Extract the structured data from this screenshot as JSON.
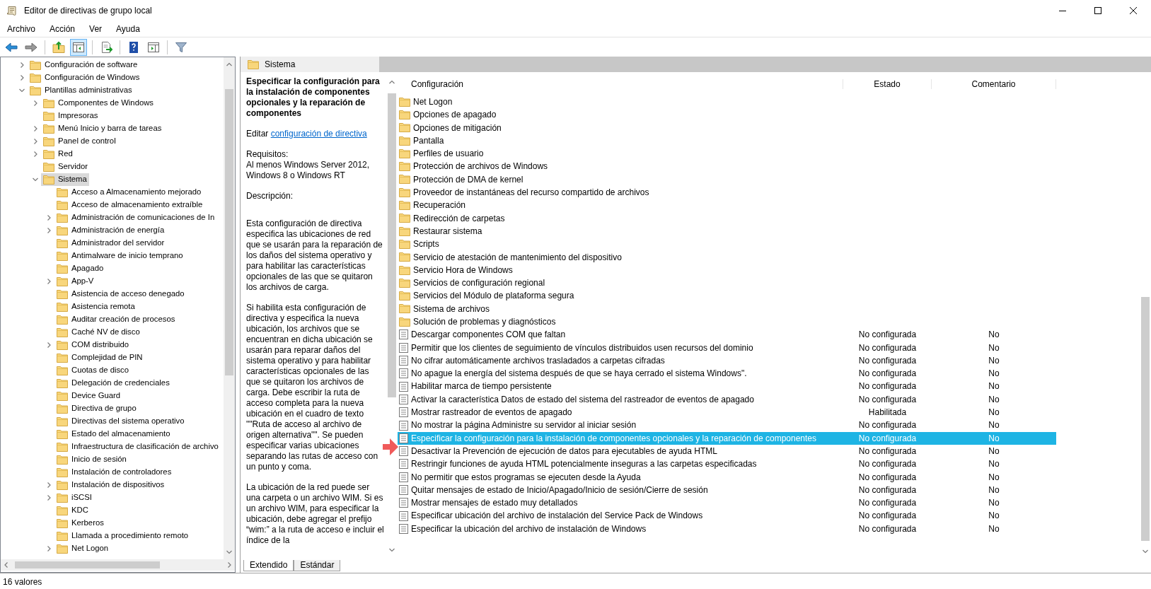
{
  "window": {
    "title": "Editor de directivas de grupo local"
  },
  "menu": [
    "Archivo",
    "Acción",
    "Ver",
    "Ayuda"
  ],
  "toolbar": [
    [
      {
        "kind": "back",
        "pressed": false
      },
      {
        "kind": "forward",
        "pressed": false
      }
    ],
    [
      {
        "kind": "up",
        "pressed": false
      },
      {
        "kind": "tree",
        "pressed": true
      }
    ],
    [
      {
        "kind": "export",
        "pressed": false
      }
    ],
    [
      {
        "kind": "help",
        "pressed": false
      },
      {
        "kind": "pane",
        "pressed": false
      }
    ],
    [
      {
        "kind": "filter",
        "pressed": false
      }
    ]
  ],
  "tree": [
    {
      "label": "Configuración de software",
      "expandable": true,
      "expanded": false,
      "selected": false
    },
    {
      "label": "Configuración de Windows",
      "expandable": true,
      "expanded": false,
      "selected": false
    },
    {
      "label": "Plantillas administrativas",
      "expandable": true,
      "expanded": true,
      "selected": false,
      "children": [
        {
          "label": "Componentes de Windows",
          "expandable": true,
          "expanded": false,
          "selected": false
        },
        {
          "label": "Impresoras",
          "expandable": false,
          "selected": false
        },
        {
          "label": "Menú Inicio y barra de tareas",
          "expandable": true,
          "expanded": false,
          "selected": false
        },
        {
          "label": "Panel de control",
          "expandable": true,
          "expanded": false,
          "selected": false
        },
        {
          "label": "Red",
          "expandable": true,
          "expanded": false,
          "selected": false
        },
        {
          "label": "Servidor",
          "expandable": false,
          "selected": false
        },
        {
          "label": "Sistema",
          "expandable": true,
          "expanded": true,
          "selected": true,
          "children": [
            {
              "label": "Acceso a Almacenamiento mejorado",
              "expandable": false,
              "selected": false
            },
            {
              "label": "Acceso de almacenamiento extraíble",
              "expandable": false,
              "selected": false
            },
            {
              "label": "Administración de comunicaciones de In",
              "expandable": true,
              "expanded": false,
              "selected": false
            },
            {
              "label": "Administración de energía",
              "expandable": true,
              "expanded": false,
              "selected": false
            },
            {
              "label": "Administrador del servidor",
              "expandable": false,
              "selected": false
            },
            {
              "label": "Antimalware de inicio temprano",
              "expandable": false,
              "selected": false
            },
            {
              "label": "Apagado",
              "expandable": false,
              "selected": false
            },
            {
              "label": "App-V",
              "expandable": true,
              "expanded": false,
              "selected": false
            },
            {
              "label": "Asistencia de acceso denegado",
              "expandable": false,
              "selected": false
            },
            {
              "label": "Asistencia remota",
              "expandable": false,
              "selected": false
            },
            {
              "label": "Auditar creación de procesos",
              "expandable": false,
              "selected": false
            },
            {
              "label": "Caché NV de disco",
              "expandable": false,
              "selected": false
            },
            {
              "label": "COM distribuido",
              "expandable": true,
              "expanded": false,
              "selected": false
            },
            {
              "label": "Complejidad de PIN",
              "expandable": false,
              "selected": false
            },
            {
              "label": "Cuotas de disco",
              "expandable": false,
              "selected": false
            },
            {
              "label": "Delegación de credenciales",
              "expandable": false,
              "selected": false
            },
            {
              "label": "Device Guard",
              "expandable": false,
              "selected": false
            },
            {
              "label": "Directiva de grupo",
              "expandable": false,
              "selected": false
            },
            {
              "label": "Directivas del sistema operativo",
              "expandable": false,
              "selected": false
            },
            {
              "label": "Estado del almacenamiento",
              "expandable": false,
              "selected": false
            },
            {
              "label": "Infraestructura de clasificación de archivo",
              "expandable": false,
              "selected": false
            },
            {
              "label": "Inicio de sesión",
              "expandable": false,
              "selected": false
            },
            {
              "label": "Instalación de controladores",
              "expandable": false,
              "selected": false
            },
            {
              "label": "Instalación de dispositivos",
              "expandable": true,
              "expanded": false,
              "selected": false
            },
            {
              "label": "iSCSI",
              "expandable": true,
              "expanded": false,
              "selected": false
            },
            {
              "label": "KDC",
              "expandable": false,
              "selected": false
            },
            {
              "label": "Kerberos",
              "expandable": false,
              "selected": false
            },
            {
              "label": "Llamada a procedimiento remoto",
              "expandable": false,
              "selected": false
            },
            {
              "label": "Net Logon",
              "expandable": true,
              "expanded": false,
              "selected": false
            }
          ]
        }
      ]
    }
  ],
  "panel_header": "Sistema",
  "description": {
    "title": "Especificar la configuración para la instalación de componentes opcionales y la reparación de componentes",
    "edit_prefix": "Editar",
    "edit_link": "configuración de directiva",
    "requirements_label": "Requisitos:",
    "requirements": "Al menos Windows Server 2012, Windows 8 o Windows RT",
    "description_label": "Descripción:",
    "paragraphs": [
      "Esta configuración de directiva especifica las ubicaciones de red que se usarán para la reparación de los daños del sistema operativo y para habilitar las características opcionales de las que se quitaron los archivos de carga.",
      "Si habilita esta configuración de directiva y especifica la nueva ubicación, los archivos que se encuentran en dicha ubicación se usarán para reparar daños del sistema operativo y para habilitar características opcionales de las que se quitaron los archivos de carga. Debe escribir la ruta de acceso completa para la nueva ubicación en el cuadro de texto \"\"Ruta de acceso al archivo de origen alternativa\"\". Se pueden especificar varias ubicaciones separando las rutas de acceso con un punto y coma.",
      "La ubicación de la red puede ser una carpeta o un archivo WIM. Si es un archivo WIM, para especificar la ubicación, debe agregar el prefijo “wim:” a la ruta de acceso e incluir el índice de la"
    ]
  },
  "table": {
    "columns": [
      "Configuración",
      "Estado",
      "Comentario"
    ],
    "rows": [
      {
        "kind": "folder",
        "name": "Net Logon",
        "selected": false
      },
      {
        "kind": "folder",
        "name": "Opciones de apagado",
        "selected": false
      },
      {
        "kind": "folder",
        "name": "Opciones de mitigación",
        "selected": false
      },
      {
        "kind": "folder",
        "name": "Pantalla",
        "selected": false
      },
      {
        "kind": "folder",
        "name": "Perfiles de usuario",
        "selected": false
      },
      {
        "kind": "folder",
        "name": "Protección de archivos de Windows",
        "selected": false
      },
      {
        "kind": "folder",
        "name": "Protección de DMA de kernel",
        "selected": false
      },
      {
        "kind": "folder",
        "name": "Proveedor de instantáneas del recurso compartido de archivos",
        "selected": false
      },
      {
        "kind": "folder",
        "name": "Recuperación",
        "selected": false
      },
      {
        "kind": "folder",
        "name": "Redirección de carpetas",
        "selected": false
      },
      {
        "kind": "folder",
        "name": "Restaurar sistema",
        "selected": false
      },
      {
        "kind": "folder",
        "name": "Scripts",
        "selected": false
      },
      {
        "kind": "folder",
        "name": "Servicio de atestación de mantenimiento del dispositivo",
        "selected": false
      },
      {
        "kind": "folder",
        "name": "Servicio Hora de Windows",
        "selected": false
      },
      {
        "kind": "folder",
        "name": "Servicios de configuración regional",
        "selected": false
      },
      {
        "kind": "folder",
        "name": "Servicios del Módulo de plataforma segura",
        "selected": false
      },
      {
        "kind": "folder",
        "name": "Sistema de archivos",
        "selected": false
      },
      {
        "kind": "folder",
        "name": "Solución de problemas y diagnósticos",
        "selected": false
      },
      {
        "kind": "setting",
        "name": "Descargar componentes COM que faltan",
        "state": "No configurada",
        "comment": "No",
        "selected": false
      },
      {
        "kind": "setting",
        "name": "Permitir que los clientes de seguimiento de vínculos distribuidos usen recursos del dominio",
        "state": "No configurada",
        "comment": "No",
        "selected": false
      },
      {
        "kind": "setting",
        "name": "No cifrar automáticamente archivos trasladados a carpetas cifradas",
        "state": "No configurada",
        "comment": "No",
        "selected": false
      },
      {
        "kind": "setting",
        "name": "No apague la energía del sistema después de que se haya cerrado el sistema Windows\".",
        "state": "No configurada",
        "comment": "No",
        "selected": false
      },
      {
        "kind": "setting",
        "name": "Habilitar marca de tiempo persistente",
        "state": "No configurada",
        "comment": "No",
        "selected": false
      },
      {
        "kind": "setting",
        "name": "Activar la característica Datos de estado del sistema del rastreador de eventos de apagado",
        "state": "No configurada",
        "comment": "No",
        "selected": false
      },
      {
        "kind": "setting",
        "name": "Mostrar rastreador de eventos de apagado",
        "state": "Habilitada",
        "comment": "No",
        "selected": false
      },
      {
        "kind": "setting",
        "name": "No mostrar la página Administre su servidor al iniciar sesión",
        "state": "No configurada",
        "comment": "No",
        "selected": false
      },
      {
        "kind": "setting",
        "name": "Especificar la configuración para la instalación de componentes opcionales y la reparación de componentes",
        "state": "No configurada",
        "comment": "No",
        "selected": true
      },
      {
        "kind": "setting",
        "name": "Desactivar la Prevención de ejecución de datos para ejecutables de ayuda HTML",
        "state": "No configurada",
        "comment": "No",
        "selected": false
      },
      {
        "kind": "setting",
        "name": "Restringir funciones de ayuda HTML potencialmente inseguras a las carpetas especificadas",
        "state": "No configurada",
        "comment": "No",
        "selected": false
      },
      {
        "kind": "setting",
        "name": "No permitir que estos programas se ejecuten desde la Ayuda",
        "state": "No configurada",
        "comment": "No",
        "selected": false
      },
      {
        "kind": "setting",
        "name": "Quitar mensajes de estado de Inicio/Apagado/Inicio de sesión/Cierre de sesión",
        "state": "No configurada",
        "comment": "No",
        "selected": false
      },
      {
        "kind": "setting",
        "name": "Mostrar mensajes de estado muy detallados",
        "state": "No configurada",
        "comment": "No",
        "selected": false
      },
      {
        "kind": "setting",
        "name": "Especificar ubicación del archivo de instalación del Service Pack de Windows",
        "state": "No configurada",
        "comment": "No",
        "selected": false
      },
      {
        "kind": "setting",
        "name": "Especificar la ubicación del archivo de instalación de Windows",
        "state": "No configurada",
        "comment": "No",
        "selected": false
      }
    ]
  },
  "view_tabs": [
    {
      "label": "Extendido",
      "selected": true
    },
    {
      "label": "Estándar",
      "selected": false
    }
  ],
  "status_bar": "16 valores"
}
